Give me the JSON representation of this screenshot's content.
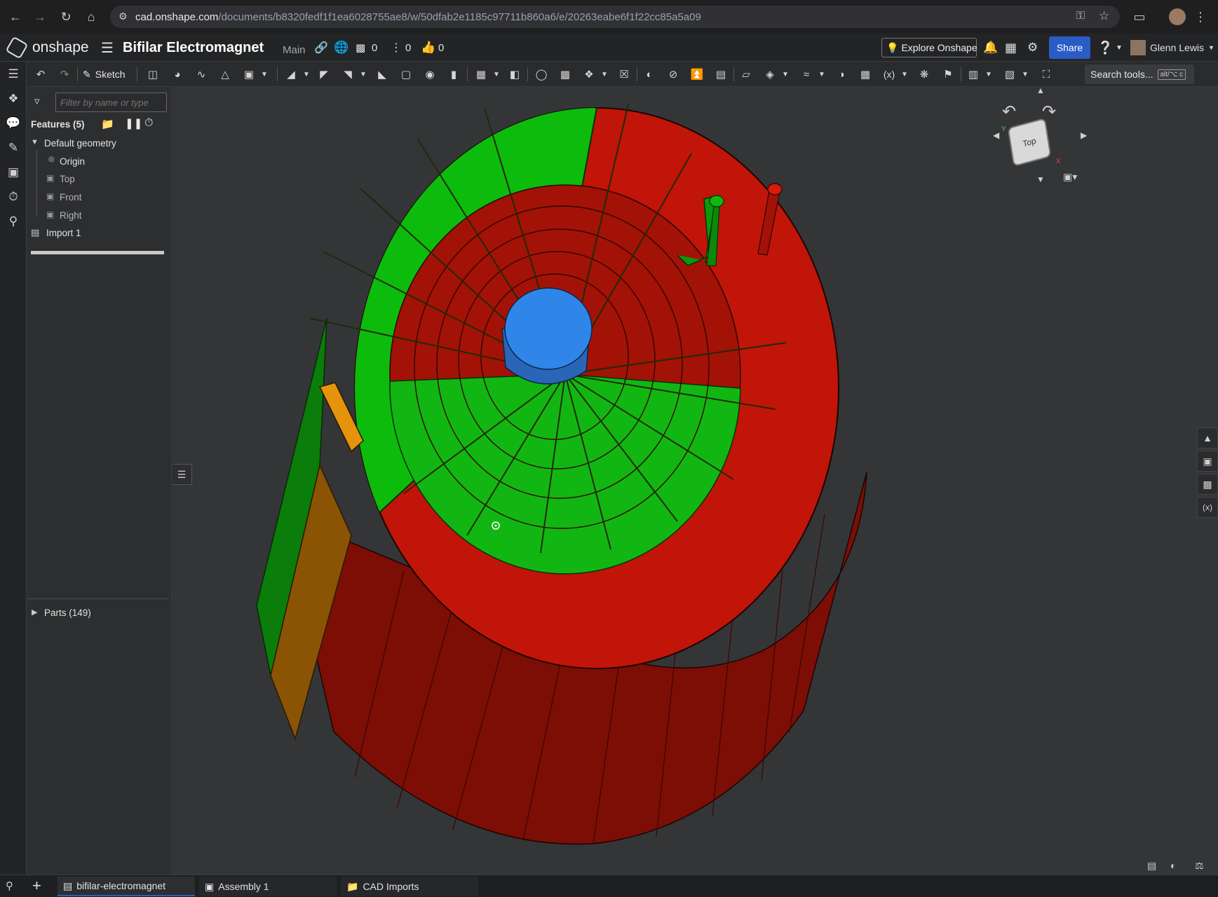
{
  "browser": {
    "url_host": "cad.onshape.com",
    "url_path": "/documents/b8320fedf1f1ea6028755ae8/w/50dfab2e1185c97711b860a6/e/20263eabe6f1f22cc85a5a09"
  },
  "header": {
    "logo_text": "onshape",
    "document_title": "Bifilar Electromagnet",
    "branch": "Main",
    "count_versions": "0",
    "count_branches": "0",
    "count_likes": "0",
    "explore_label": "Explore Onshape",
    "share_label": "Share",
    "user_name": "Glenn Lewis"
  },
  "toolbar": {
    "sketch_label": "Sketch",
    "search_label": "Search tools...",
    "search_shortcut": "alt/⌥ c"
  },
  "features": {
    "filter_placeholder": "Filter by name or type",
    "title": "Features (5)",
    "default_geometry": "Default geometry",
    "items": [
      "Origin",
      "Top",
      "Front",
      "Right"
    ],
    "import_label": "Import 1",
    "parts_label": "Parts (149)"
  },
  "viewcube": {
    "face_label": "Top"
  },
  "tabs": [
    {
      "label": "bifilar-electromagnet"
    },
    {
      "label": "Assembly 1"
    },
    {
      "label": "CAD Imports"
    }
  ],
  "colors": {
    "green": "#0dbb0d",
    "red": "#c01508",
    "blue": "#2f86e8",
    "orange": "#e5930c",
    "accent": "#2a5cc6"
  }
}
